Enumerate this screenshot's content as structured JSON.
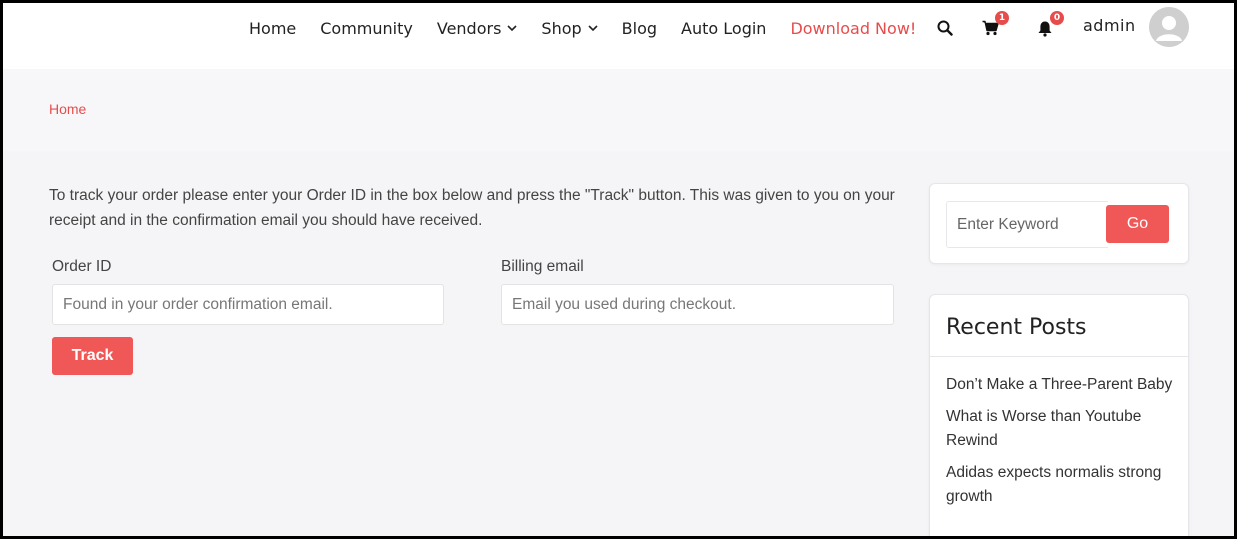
{
  "header": {
    "nav": [
      {
        "label": "Home",
        "dropdown": false
      },
      {
        "label": "Community",
        "dropdown": false
      },
      {
        "label": "Vendors",
        "dropdown": true
      },
      {
        "label": "Shop",
        "dropdown": true
      },
      {
        "label": "Blog",
        "dropdown": false
      },
      {
        "label": "Auto Login",
        "dropdown": false
      },
      {
        "label": "Download Now!",
        "dropdown": false,
        "highlight": true
      }
    ],
    "cart_count": "1",
    "notification_count": "0",
    "username": "admin",
    "icons": [
      "search-icon",
      "cart-icon",
      "bell-icon",
      "avatar"
    ]
  },
  "breadcrumb": {
    "home": "Home"
  },
  "main": {
    "intro": "To track your order please enter your Order ID in the box below and press the \"Track\" button. This was given to you on your receipt and in the confirmation email you should have received.",
    "order_id_label": "Order ID",
    "order_id_placeholder": "Found in your order confirmation email.",
    "billing_email_label": "Billing email",
    "billing_email_placeholder": "Email you used during checkout.",
    "track_label": "Track"
  },
  "sidebar": {
    "search_placeholder": "Enter Keyword",
    "go_label": "Go",
    "recent_posts_title": "Recent Posts",
    "recent_posts": [
      "Don’t Make a Three-Parent Baby",
      "What is Worse than Youtube Rewind",
      "Adidas expects normalis strong growth"
    ]
  },
  "colors": {
    "accent": "#f05757",
    "link": "#e74c4c",
    "background": "#f7f7f9"
  }
}
